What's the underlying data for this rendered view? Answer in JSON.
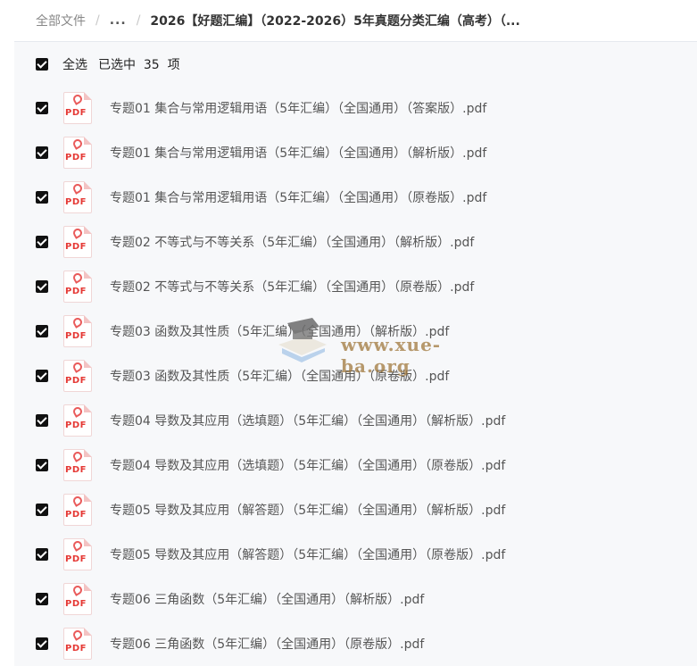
{
  "breadcrumb": {
    "root": "全部文件",
    "ellipsis": "...",
    "current": "2026【好题汇编】（2022-2026）5年真题分类汇编（高考）（..."
  },
  "selection": {
    "select_all_label": "全选",
    "status_text": "已选中  35  项"
  },
  "files": [
    {
      "name": "专题01 集合与常用逻辑用语（5年汇编）（全国通用）（答案版）.pdf",
      "icon": "pdf-icon",
      "checked": true
    },
    {
      "name": "专题01 集合与常用逻辑用语（5年汇编）（全国通用）（解析版）.pdf",
      "icon": "pdf-icon",
      "checked": true
    },
    {
      "name": "专题01 集合与常用逻辑用语（5年汇编）（全国通用）（原卷版）.pdf",
      "icon": "pdf-icon",
      "checked": true
    },
    {
      "name": "专题02 不等式与不等关系（5年汇编）（全国通用）（解析版）.pdf",
      "icon": "pdf-icon",
      "checked": true
    },
    {
      "name": "专题02 不等式与不等关系（5年汇编）（全国通用）（原卷版）.pdf",
      "icon": "pdf-icon",
      "checked": true
    },
    {
      "name": "专题03 函数及其性质（5年汇编）（全国通用）（解析版）.pdf",
      "icon": "pdf-icon",
      "checked": true
    },
    {
      "name": "专题03 函数及其性质（5年汇编）（全国通用）（原卷版）.pdf",
      "icon": "pdf-icon",
      "checked": true
    },
    {
      "name": "专题04 导数及其应用（选填题）（5年汇编）（全国通用）（解析版）.pdf",
      "icon": "pdf-icon",
      "checked": true
    },
    {
      "name": "专题04 导数及其应用（选填题）（5年汇编）（全国通用）（原卷版）.pdf",
      "icon": "pdf-icon",
      "checked": true
    },
    {
      "name": "专题05 导数及其应用（解答题）（5年汇编）（全国通用）（解析版）.pdf",
      "icon": "pdf-icon",
      "checked": true
    },
    {
      "name": "专题05 导数及其应用（解答题）（5年汇编）（全国通用）（原卷版）.pdf",
      "icon": "pdf-icon",
      "checked": true
    },
    {
      "name": "专题06 三角函数（5年汇编）（全国通用）（解析版）.pdf",
      "icon": "pdf-icon",
      "checked": true
    },
    {
      "name": "专题06 三角函数（5年汇编）（全国通用）（原卷版）.pdf",
      "icon": "pdf-icon",
      "checked": true
    }
  ],
  "watermark": {
    "text": "www.xue-ba.org"
  },
  "colors": {
    "checkbox": "#111111",
    "pdf_red": "#e53935",
    "list_bg": "#f7f8fa"
  }
}
